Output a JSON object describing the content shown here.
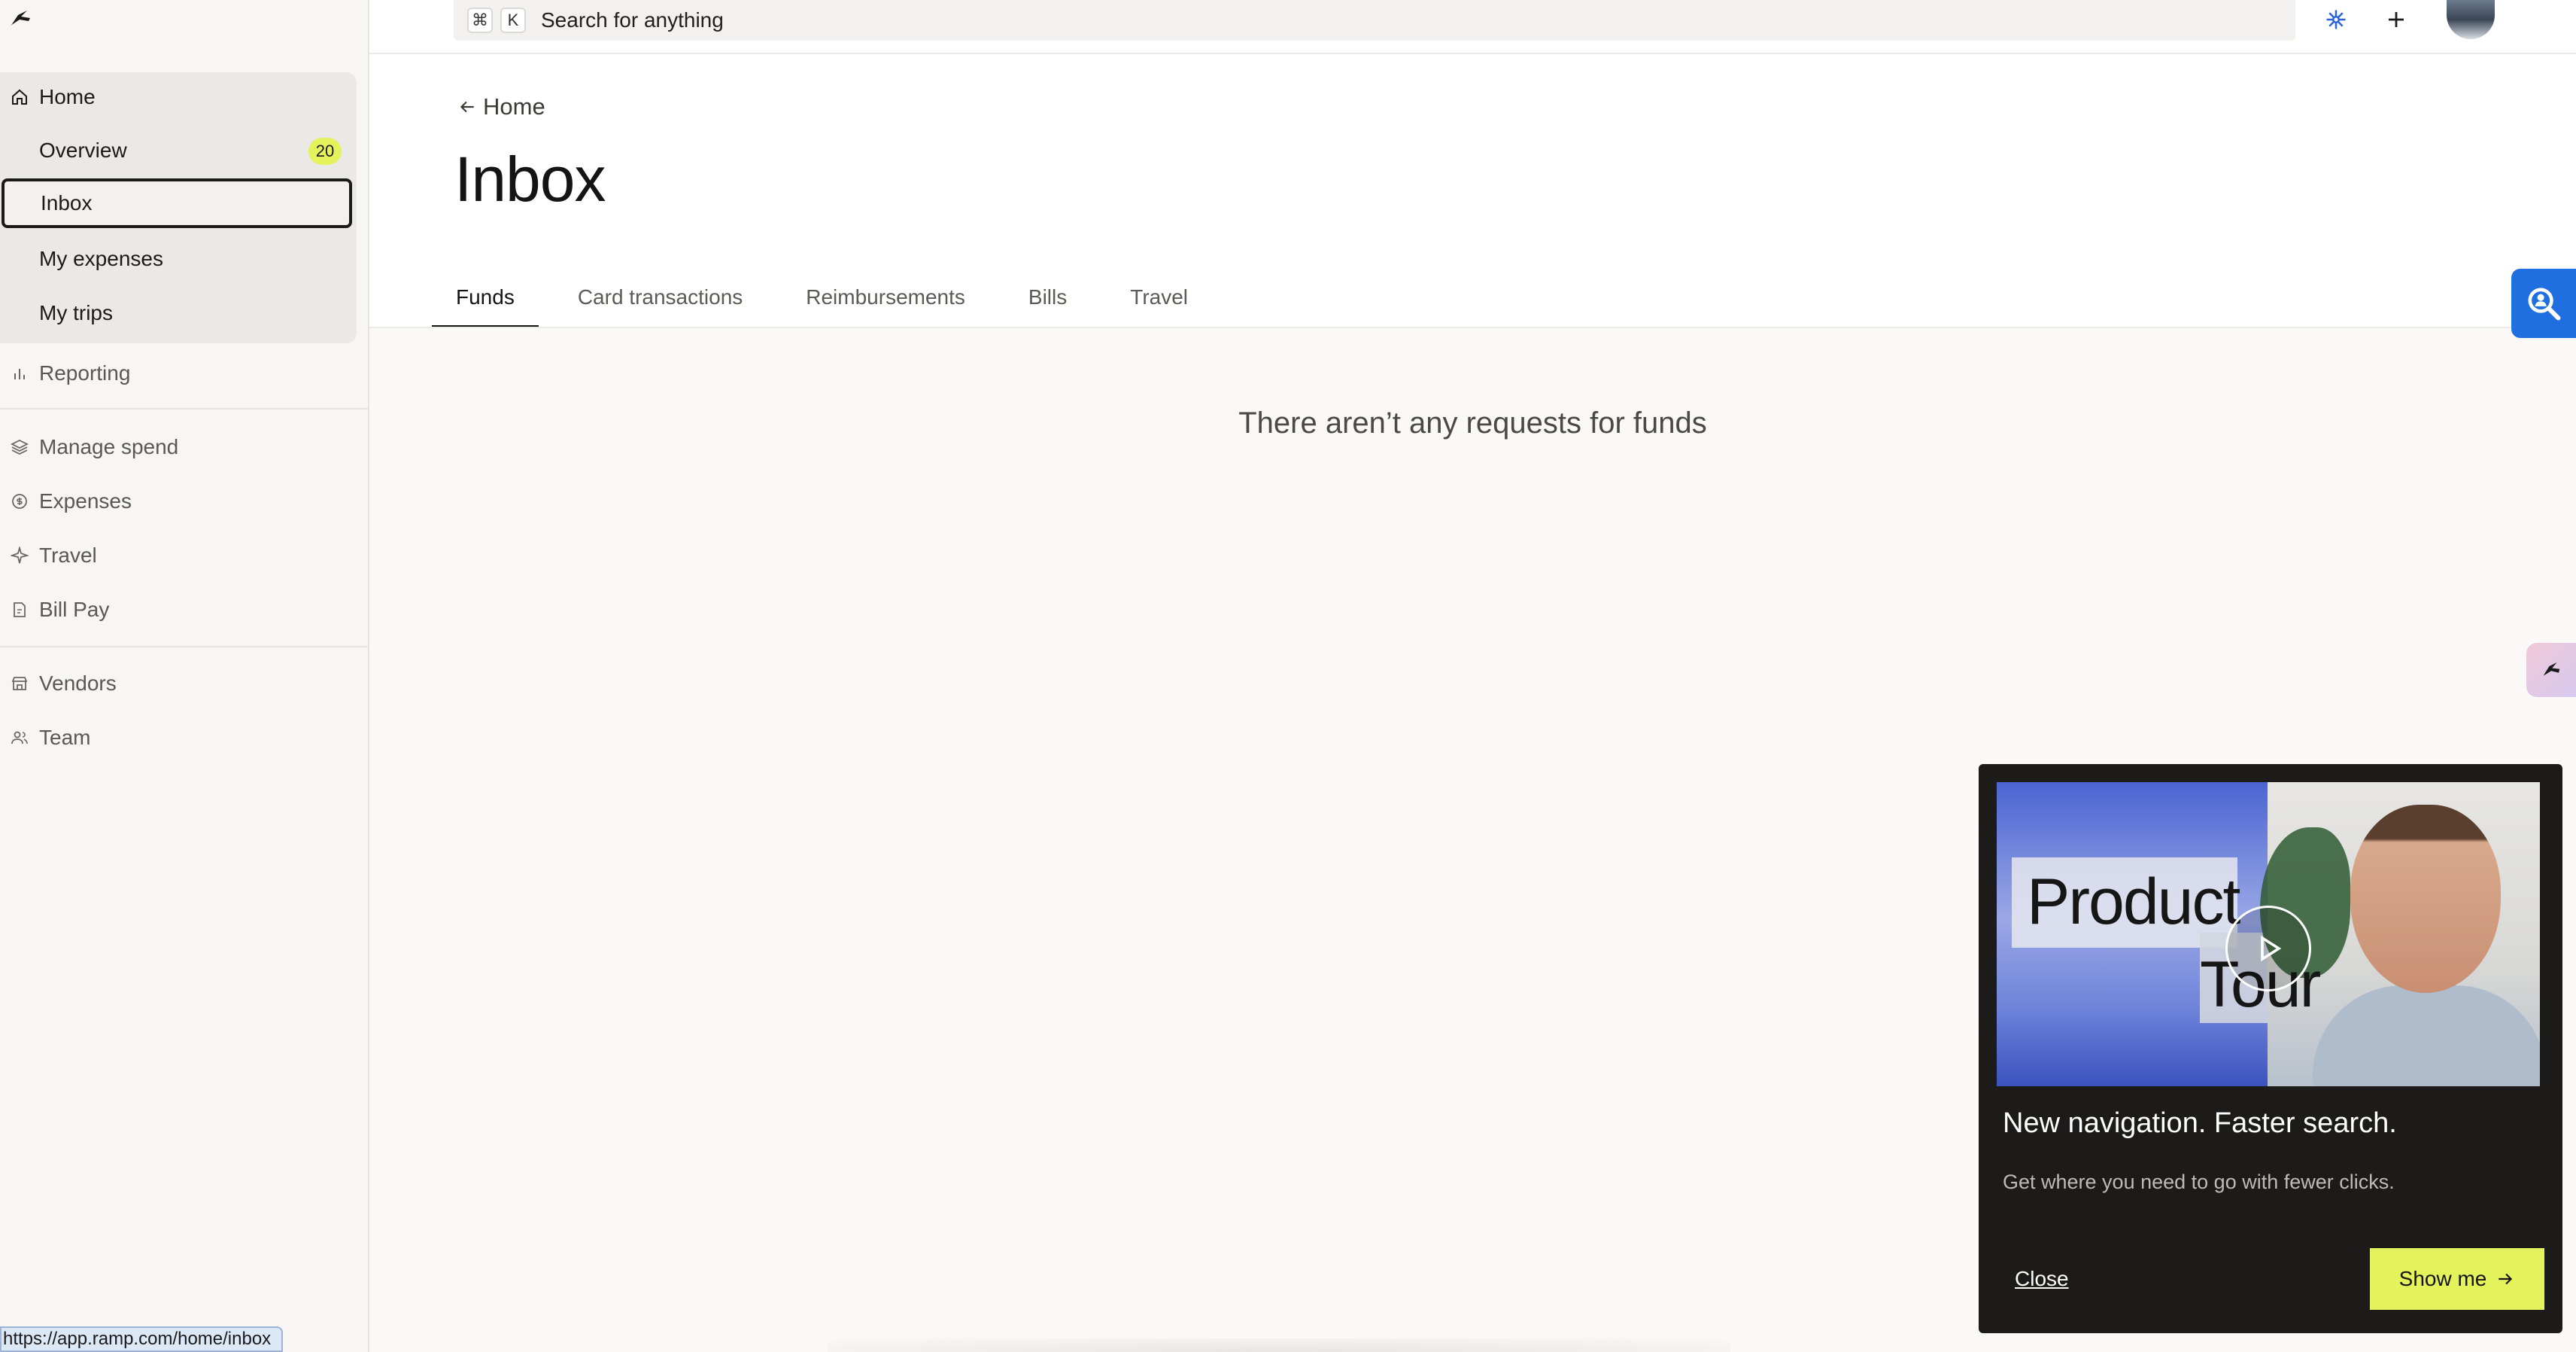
{
  "search": {
    "shortcut_cmd": "⌘",
    "shortcut_key": "K",
    "placeholder": "Search for anything"
  },
  "sidebar": {
    "home": "Home",
    "home_items": [
      {
        "label": "Overview",
        "badge": "20"
      },
      {
        "label": "Inbox"
      },
      {
        "label": "My expenses"
      },
      {
        "label": "My trips"
      }
    ],
    "reporting": "Reporting",
    "manage_spend": "Manage spend",
    "expenses": "Expenses",
    "travel": "Travel",
    "bill_pay": "Bill Pay",
    "vendors": "Vendors",
    "team": "Team"
  },
  "main": {
    "back_label": "Home",
    "title": "Inbox",
    "tabs": [
      "Funds",
      "Card transactions",
      "Reimbursements",
      "Bills",
      "Travel"
    ],
    "active_tab": "Funds",
    "empty_message": "There aren’t any requests for funds"
  },
  "tour": {
    "media_word1": "Product",
    "media_word2": "Tour",
    "title": "New navigation. Faster search.",
    "description": "Get where you need to go with fewer clicks.",
    "close_label": "Close",
    "cta_label": "Show me"
  },
  "status_url": "https://app.ramp.com/home/inbox",
  "colors": {
    "accent": "#e4f25b",
    "help_widget": "#1f6fe0",
    "popup_bg": "#1c1b1a"
  }
}
